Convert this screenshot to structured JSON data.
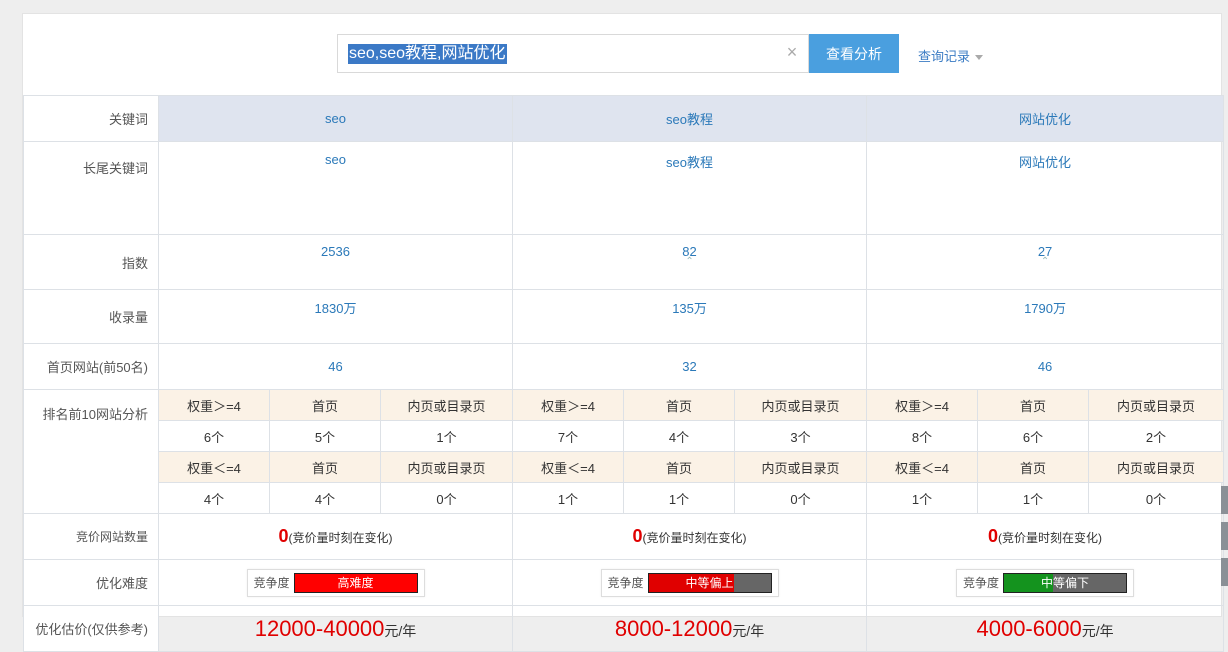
{
  "search": {
    "query": "seo,seo教程,网站优化",
    "analyze_label": "查看分析",
    "history_label": "查询记录"
  },
  "labels": {
    "keyword": "关键词",
    "long_tail": "长尾关键词",
    "index": "指数",
    "indexed": "收录量",
    "home_sites": "首页网站(前50名)",
    "top10": "排名前10网站分析",
    "bid_sites": "竞价网站数量",
    "difficulty": "优化难度",
    "price": "优化估价(仅供参考)"
  },
  "sub_headers": {
    "weight_ge": "权重＞=4",
    "weight_le": "权重＜=4",
    "home": "首页",
    "inner": "内页或目录页"
  },
  "competition_label": "竞争度",
  "bid_note": "(竞价量时刻在变化)",
  "price_unit": "元/年",
  "columns": [
    {
      "keyword": "seo",
      "long_tail": "seo",
      "index": "2536",
      "index_mark": "",
      "indexed": "1830万",
      "home_sites": "46",
      "ge": [
        "6个",
        "5个",
        "1个"
      ],
      "le": [
        "4个",
        "4个",
        "0个"
      ],
      "bid_count": "0",
      "difficulty": {
        "label": "高难度",
        "level": 1.0,
        "color": "#ff0000"
      },
      "price": "12000-40000"
    },
    {
      "keyword": "seo教程",
      "long_tail": "seo教程",
      "index": "82",
      "index_mark": "⌃",
      "indexed": "135万",
      "home_sites": "32",
      "ge": [
        "7个",
        "4个",
        "3个"
      ],
      "le": [
        "1个",
        "1个",
        "0个"
      ],
      "bid_count": "0",
      "difficulty": {
        "label": "中等偏上",
        "level": 0.7,
        "color": "#e00000"
      },
      "price": "8000-12000"
    },
    {
      "keyword": "网站优化",
      "long_tail": "网站优化",
      "index": "27",
      "index_mark": "⌃",
      "indexed": "1790万",
      "home_sites": "46",
      "ge": [
        "8个",
        "6个",
        "2个"
      ],
      "le": [
        "1个",
        "1个",
        "0个"
      ],
      "bid_count": "0",
      "difficulty": {
        "label": "中等偏下",
        "level": 0.4,
        "color": "#14931e"
      },
      "price": "4000-6000"
    }
  ]
}
